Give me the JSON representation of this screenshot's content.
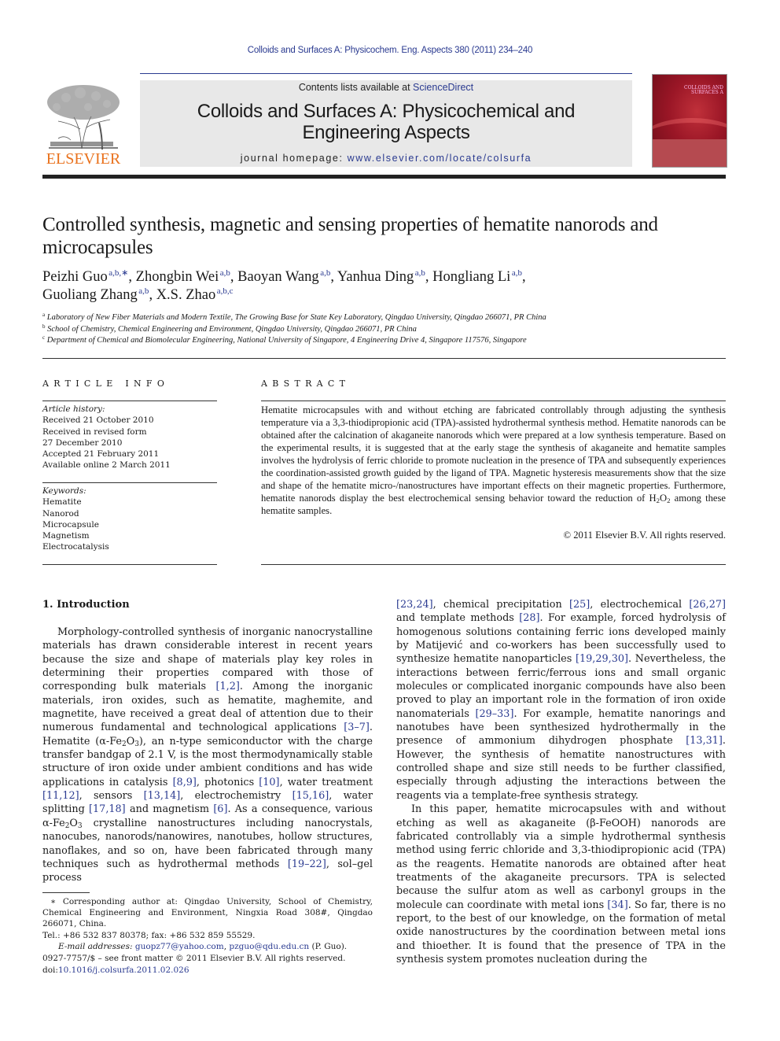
{
  "header": {
    "journal_ref": "Colloids and Surfaces A: Physicochem. Eng. Aspects 380 (2011) 234–240",
    "publisher_logo_text": "ELSEVIER",
    "contents_prefix": "Contents lists available at ",
    "contents_link": "ScienceDirect",
    "journal_title_line1": "Colloids and Surfaces A: Physicochemical and",
    "journal_title_line2": "Engineering Aspects",
    "homepage_prefix": "journal homepage: ",
    "homepage_url": "www.elsevier.com/locate/colsurfa",
    "cover_title": "COLLOIDS AND SURFACES A",
    "colors": {
      "link": "#2a3a90",
      "elsevier_orange": "#e9711c",
      "cover_red": "#9a1626",
      "masthead_bg": "#e8e8e8"
    }
  },
  "article": {
    "title": "Controlled synthesis, magnetic and sensing properties of hematite nanorods and microcapsules",
    "authors": [
      {
        "name": "Peizhi Guo",
        "aff": "a,b,∗",
        "sep": ", "
      },
      {
        "name": "Zhongbin Wei",
        "aff": "a,b",
        "sep": ", "
      },
      {
        "name": "Baoyan Wang",
        "aff": "a,b",
        "sep": ", "
      },
      {
        "name": "Yanhua Ding",
        "aff": "a,b",
        "sep": ", "
      },
      {
        "name": "Hongliang Li",
        "aff": "a,b",
        "sep": ","
      },
      {
        "name": "Guoliang Zhang",
        "aff": "a,b",
        "sep": ", "
      },
      {
        "name": "X.S. Zhao",
        "aff": "a,b,c",
        "sep": ""
      }
    ],
    "affiliations": [
      {
        "key": "a",
        "text": "Laboratory of New Fiber Materials and Modern Textile, The Growing Base for State Key Laboratory, Qingdao University, Qingdao 266071, PR China"
      },
      {
        "key": "b",
        "text": "School of Chemistry, Chemical Engineering and Environment, Qingdao University, Qingdao 266071, PR China"
      },
      {
        "key": "c",
        "text": "Department of Chemical and Biomolecular Engineering, National University of Singapore, 4 Engineering Drive 4, Singapore 117576, Singapore"
      }
    ]
  },
  "article_info": {
    "heading": "ARTICLE INFO",
    "history_label": "Article history:",
    "history": [
      "Received 21 October 2010",
      "Received in revised form",
      "27 December 2010",
      "Accepted 21 February 2011",
      "Available online 2 March 2011"
    ],
    "keywords_label": "Keywords:",
    "keywords": [
      "Hematite",
      "Nanorod",
      "Microcapsule",
      "Magnetism",
      "Electrocatalysis"
    ]
  },
  "abstract": {
    "heading": "ABSTRACT",
    "text_part1": "Hematite microcapsules with and without etching are fabricated controllably through adjusting the synthesis temperature via a 3,3-thiodipropionic acid (TPA)-assisted hydrothermal synthesis method. Hematite nanorods can be obtained after the calcination of akaganeite nanorods which were prepared at a low synthesis temperature. Based on the experimental results, it is suggested that at the early stage the synthesis of akaganeite and hematite samples involves the hydrolysis of ferric chloride to promote nucleation in the presence of TPA and subsequently experiences the coordination-assisted growth guided by the ligand of TPA. Magnetic hysteresis measurements show that the size and shape of the hematite micro-/nanostructures have important effects on their magnetic properties. Furthermore, hematite nanorods display the best electrochemical sensing behavior toward the reduction of H",
    "sub1": "2",
    "mid": "O",
    "sub2": "2",
    "text_part2": " among these hematite samples.",
    "copyright": "© 2011 Elsevier B.V. All rights reserved."
  },
  "body": {
    "intro_heading": "1.  Introduction",
    "left_p1": [
      "Morphology-controlled synthesis of inorganic nanocrystalline materials has drawn considerable interest in recent years because the size and shape of materials play key roles in determining their properties compared with those of corresponding bulk materials ",
      "[1,2]",
      ". Among the inorganic materials, iron oxides, such as hematite, maghemite, and magnetite, have received a great deal of attention due to their numerous fundamental and technological applications ",
      "[3–7]",
      ". Hematite (α-Fe",
      "2",
      "O",
      "3",
      "), an n-type semiconductor with the charge transfer bandgap of 2.1 V, is the most thermodynamically stable structure of iron oxide under ambient conditions and has wide applications in catalysis ",
      "[8,9]",
      ", photonics ",
      "[10]",
      ", water treatment ",
      "[11,12]",
      ", sensors ",
      "[13,14]",
      ", electrochemistry ",
      "[15,16]",
      ", water splitting ",
      "[17,18]",
      " and magnetism ",
      "[6]",
      ". As a consequence, various α-Fe",
      "2",
      "O",
      "3",
      " crystalline nanostructures including nanocrystals, nanocubes, nanorods/nanowires, nanotubes, hollow structures, nanoflakes, and so on, have been fabricated through many techniques such as hydrothermal methods ",
      "[19–22]",
      ", sol–gel process"
    ],
    "right_p1": [
      "[23,24]",
      ", chemical precipitation ",
      "[25]",
      ", electrochemical ",
      "[26,27]",
      " and template methods ",
      "[28]",
      ". For example, forced hydrolysis of homogenous solutions containing ferric ions developed mainly by Matijević and co-workers has been successfully used to synthesize hematite nanoparticles ",
      "[19,29,30]",
      ". Nevertheless, the interactions between ferric/ferrous ions and small organic molecules or complicated inorganic compounds have also been proved to play an important role in the formation of iron oxide nanomaterials ",
      "[29–33]",
      ". For example, hematite nanorings and nanotubes have been synthesized hydrothermally in the presence of ammonium dihydrogen phosphate ",
      "[13,31]",
      ". However, the synthesis of hematite nanostructures with controlled shape and size still needs to be further classified, especially through adjusting the interactions between the reagents via a template-free synthesis strategy."
    ],
    "right_p2": [
      "In this paper, hematite microcapsules with and without etching as well as akaganeite (β-FeOOH) nanorods are fabricated controllably via a simple hydrothermal synthesis method using ferric chloride and 3,3-thiodipropionic acid (TPA) as the reagents. Hematite nanorods are obtained after heat treatments of the akaganeite precursors. TPA is selected because the sulfur atom as well as carbonyl groups in the molecule can coordinate with metal ions ",
      "[34]",
      ". So far, there is no report, to the best of our knowledge, on the formation of metal oxide nanostructures by the coordination between metal ions and thioether. It is found that the presence of TPA in the synthesis system promotes nucleation during the"
    ]
  },
  "footnote": {
    "corresponding": "∗ Corresponding author at: Qingdao University, School of Chemistry, Chemical Engineering and Environment, Ningxia Road 308#, Qingdao 266071, China.",
    "tel": "Tel.: +86 532 837 80378; fax: +86 532 859 55529.",
    "email_label": "E-mail addresses:",
    "email1": "guopz77@yahoo.com",
    "email2": "pzguo@qdu.edu.cn",
    "email_owner": " (P. Guo).",
    "issn": "0927-7757/$ – see front matter © 2011 Elsevier B.V. All rights reserved.",
    "doi_prefix": "doi:",
    "doi": "10.1016/j.colsurfa.2011.02.026"
  }
}
